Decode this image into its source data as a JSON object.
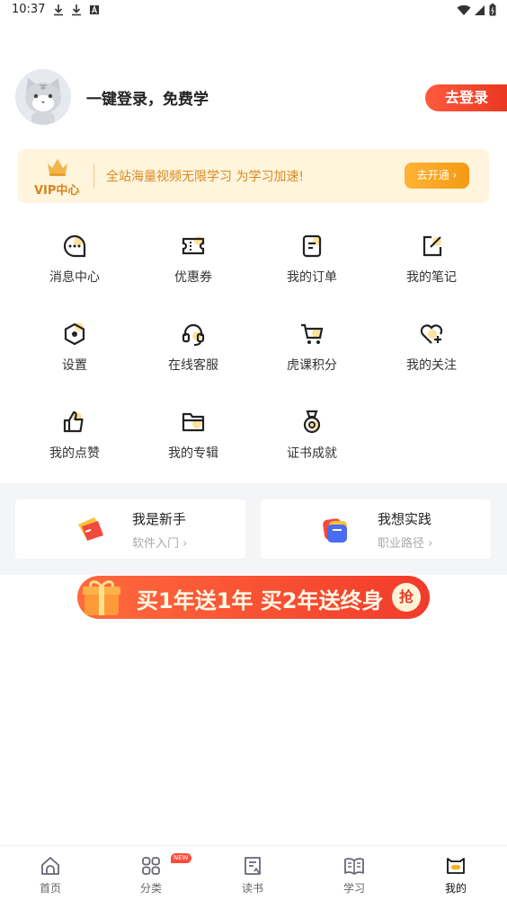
{
  "status_bar": {
    "time": "10:37",
    "left_icons": [
      "download-icon",
      "download-icon",
      "a-icon"
    ],
    "right_icons": [
      "wifi-icon",
      "signal-icon",
      "battery-icon"
    ]
  },
  "profile": {
    "login_prompt": "一键登录，免费学",
    "login_button": "去登录"
  },
  "vip": {
    "label": "VIP中心",
    "text": "全站海量视频无限学习  为学习加速!",
    "button": "去开通 ›"
  },
  "menu": [
    {
      "label": "消息中心",
      "icon": "message-icon"
    },
    {
      "label": "优惠券",
      "icon": "coupon-icon"
    },
    {
      "label": "我的订单",
      "icon": "order-icon"
    },
    {
      "label": "我的笔记",
      "icon": "note-icon"
    },
    {
      "label": "设置",
      "icon": "settings-icon"
    },
    {
      "label": "在线客服",
      "icon": "headset-icon"
    },
    {
      "label": "虎课积分",
      "icon": "cart-icon"
    },
    {
      "label": "我的关注",
      "icon": "heart-plus-icon"
    },
    {
      "label": "我的点赞",
      "icon": "thumbs-up-icon"
    },
    {
      "label": "我的专辑",
      "icon": "folder-icon"
    },
    {
      "label": "证书成就",
      "icon": "medal-icon"
    }
  ],
  "cards": [
    {
      "title": "我是新手",
      "subtitle": "软件入门 ›"
    },
    {
      "title": "我想实践",
      "subtitle": "职业路径 ›"
    }
  ],
  "banner": {
    "text": "买1年送1年 买2年送终身",
    "grab": "抢"
  },
  "tabbar": [
    {
      "label": "首页",
      "icon": "home-icon"
    },
    {
      "label": "分类",
      "icon": "category-icon",
      "badge": "NEW"
    },
    {
      "label": "读书",
      "icon": "book-icon"
    },
    {
      "label": "学习",
      "icon": "open-book-icon"
    },
    {
      "label": "我的",
      "icon": "profile-icon",
      "active": true
    }
  ],
  "colors": {
    "accent": "#f5a623",
    "login_red": "#ee3a24",
    "vip_text": "#d98a22"
  }
}
